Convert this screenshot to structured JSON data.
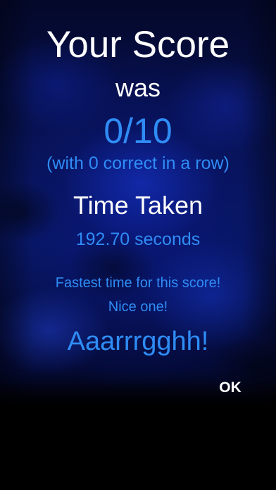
{
  "results": {
    "title": "Your Score",
    "subtitle": "was",
    "score": "0/10",
    "streak": "(with 0 correct in a row)",
    "time_heading": "Time Taken",
    "time_value": "192.70 seconds",
    "message_line1": "Fastest time for this score!",
    "message_line2": "Nice one!",
    "exclamation": "Aaarrrgghh!"
  },
  "actions": {
    "ok_label": "OK"
  },
  "colors": {
    "accent": "#2f8cf5",
    "primary_text": "#ffffff",
    "background": "#000000"
  }
}
